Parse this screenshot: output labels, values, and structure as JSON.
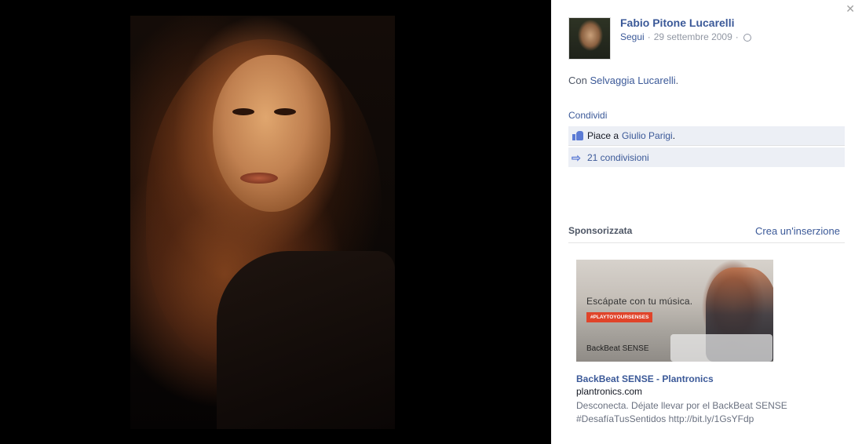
{
  "post": {
    "author_name": "Fabio Pitone Lucarelli",
    "follow_label": "Segui",
    "date": "29 settembre 2009",
    "caption_prefix": "Con",
    "tagged_person": "Selvaggia Lucarelli",
    "caption_suffix": ".",
    "share_label": "Condividi",
    "likes_prefix": "Piace a",
    "liker": "Giulio Parigi",
    "likes_suffix": ".",
    "shares_count": "21 condivisioni",
    "privacy_icon": "globe-icon",
    "close_icon": "close-icon"
  },
  "sponsored": {
    "title": "Sponsorizzata",
    "create_ad_label": "Crea un'inserzione",
    "ad": {
      "image_tagline": "Escápate con tu música.",
      "image_hashtag": "#PLAYTOYOURSENSES",
      "image_brand": "BackBeat SENSE",
      "title": "BackBeat SENSE - Plantronics",
      "domain": "plantronics.com",
      "description_line1": "Desconecta. Déjate llevar por el BackBeat SENSE",
      "description_line2": "#DesafíaTusSentidos http://bit.ly/1GsYFdp"
    }
  },
  "colors": {
    "link": "#3b5998",
    "panel_bg": "#ffffff",
    "stage_bg": "#000000",
    "action_row_bg": "#eceff5"
  }
}
